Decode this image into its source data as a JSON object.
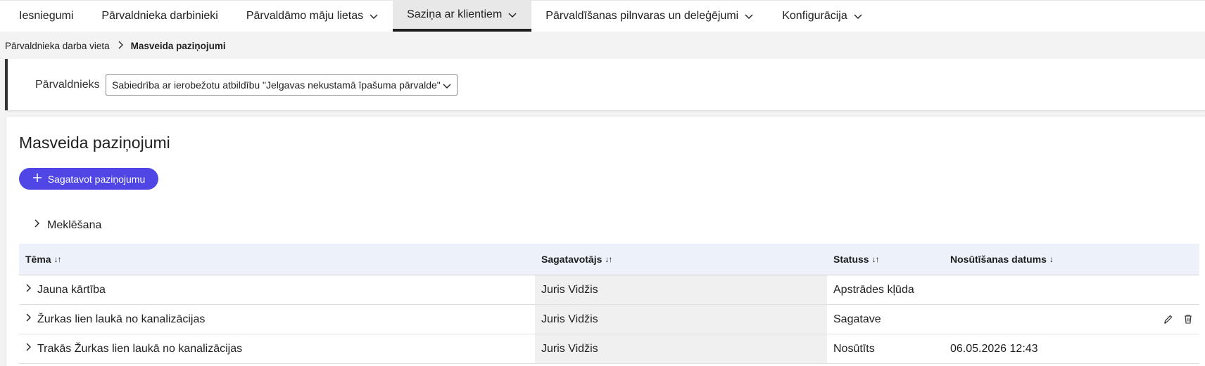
{
  "topnav": {
    "items": [
      {
        "label": "Iesniegumi",
        "has_dropdown": false,
        "active": false
      },
      {
        "label": "Pārvaldnieka darbinieki",
        "has_dropdown": false,
        "active": false
      },
      {
        "label": "Pārvaldāmo māju lietas",
        "has_dropdown": true,
        "active": false
      },
      {
        "label": "Saziņa ar klientiem",
        "has_dropdown": true,
        "active": true
      },
      {
        "label": "Pārvaldīšanas pilnvaras un deleģējumi",
        "has_dropdown": true,
        "active": false
      },
      {
        "label": "Konfigurācija",
        "has_dropdown": true,
        "active": false
      }
    ]
  },
  "breadcrumb": {
    "parent": "Pārvaldnieka darba vieta",
    "current": "Masveida paziņojumi"
  },
  "manager": {
    "label": "Pārvaldnieks",
    "selected": "Sabiedrība ar ierobežotu atbildību \"Jelgavas nekustamā īpašuma pārvalde\""
  },
  "main": {
    "title": "Masveida paziņojumi",
    "create_button": "Sagatavot paziņojumu",
    "search_label": "Meklēšana"
  },
  "table": {
    "headers": {
      "topic": "Tēma",
      "author": "Sagatavotājs",
      "status": "Statuss",
      "sent_date": "Nosūtīšanas datums"
    },
    "sort_icons": {
      "both": "↓↑",
      "desc": "↓"
    },
    "rows": [
      {
        "topic": "Jauna kārtība",
        "author": "Juris Vidžis",
        "status": "Apstrādes kļūda",
        "sent_date": "",
        "actions": false
      },
      {
        "topic": "Žurkas lien laukā no kanalizācijas",
        "author": "Juris Vidžis",
        "status": "Sagatave",
        "sent_date": "",
        "actions": true
      },
      {
        "topic": "Trakās Žurkas lien laukā no kanalizācijas",
        "author": "Juris Vidžis",
        "status": "Nosūtīts",
        "sent_date": "06.05.2026 12:43",
        "actions": false
      }
    ]
  },
  "colors": {
    "accent": "#4f46e5",
    "header_bg": "#edf2fa",
    "page_bg": "#f3f3f3"
  },
  "icons": {
    "dropdown": "chevron-down-icon",
    "expand": "chevron-right-icon",
    "create": "plus-icon",
    "edit": "pencil-icon",
    "delete": "trash-icon"
  }
}
